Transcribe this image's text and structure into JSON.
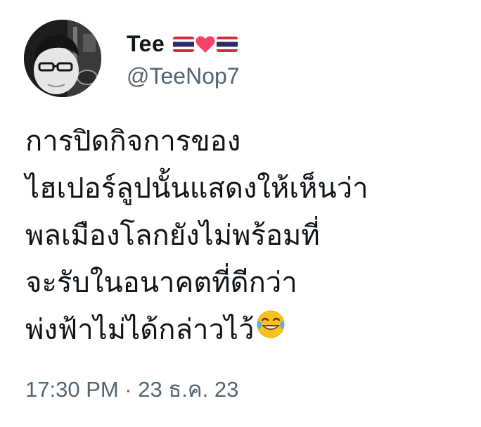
{
  "user": {
    "display_name": "Tee",
    "handle": "@TeeNop7",
    "name_emojis": [
      "thailand-flag",
      "heart",
      "thailand-flag"
    ]
  },
  "tweet": {
    "lines": [
      "การปิดกิจการของ",
      "ไฮเปอร์ลูปนั้นแสดงให้เห็นว่า",
      "พลเมืองโลกยังไม่พร้อมที่",
      "จะรับในอนาคตที่ดีกว่า",
      "พ่งฟ้าไม่ได้กล่าวไว้"
    ],
    "trailing_emoji": "face-with-tears-of-joy",
    "timestamp": "17:30 PM · 23 ธ.ค. 23"
  },
  "colors": {
    "text": "#0f1419",
    "secondary": "#536471",
    "flag_red": "#d52b3a",
    "flag_blue": "#2d2a69",
    "heart": "#f2436a"
  }
}
